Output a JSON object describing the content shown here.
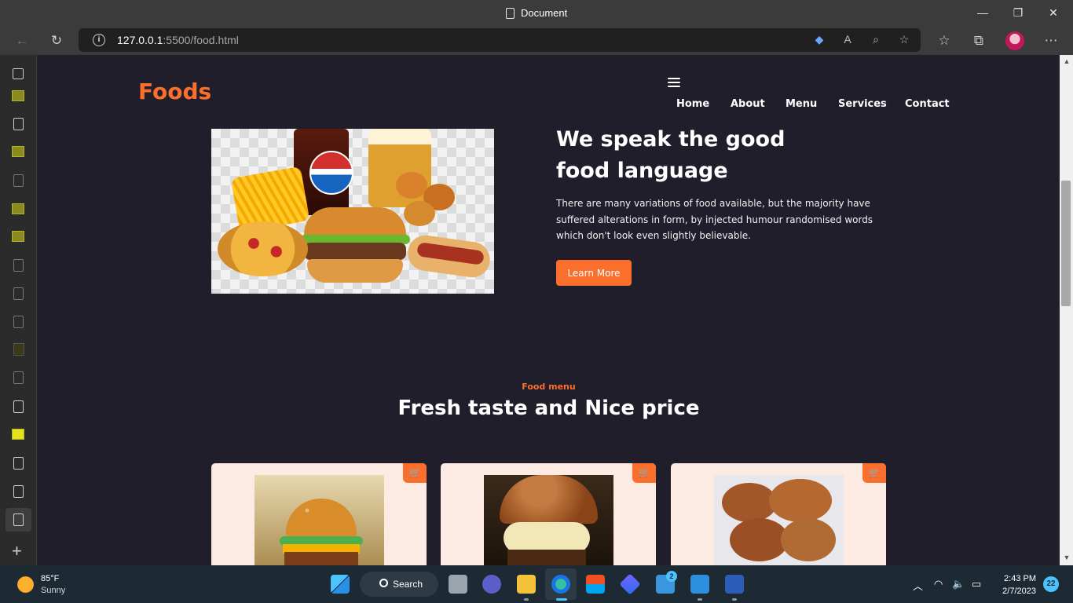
{
  "window": {
    "title": "Document"
  },
  "browser": {
    "url_host": "127.0.0.1",
    "url_path": ":5500/food.html"
  },
  "site": {
    "logo": "Foods",
    "nav": [
      "Home",
      "About",
      "Menu",
      "Services",
      "Contact"
    ],
    "hero": {
      "heading_line1": "We speak the good",
      "heading_line2": "food language",
      "text": "There are many variations of food available, but the majority have suffered alterations in form, by injected humour randomised words which don't look even slightly believable.",
      "button": "Learn More"
    },
    "menu_section": {
      "subtitle": "Food menu",
      "title": "Fresh taste and Nice price"
    }
  },
  "taskbar": {
    "temperature": "85°F",
    "condition": "Sunny",
    "search": "Search",
    "mail_badge": "2",
    "time": "2:43 PM",
    "date": "2/7/2023",
    "notifications": "22"
  },
  "colors": {
    "accent": "#fb6f2d",
    "page_bg": "#201e2b",
    "card_bg": "#fdeae3"
  }
}
